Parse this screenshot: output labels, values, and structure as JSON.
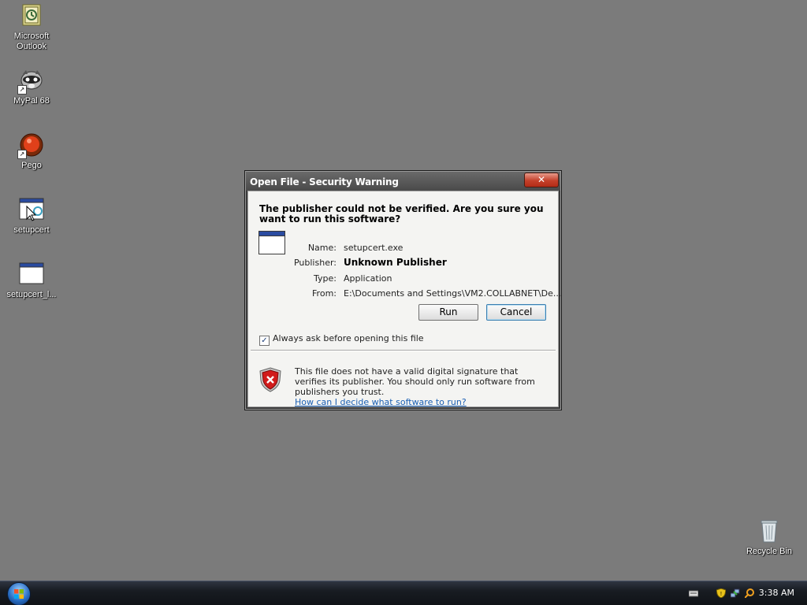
{
  "desktop": {
    "icons": [
      {
        "label_line1": "Microsoft",
        "label_line2": "Outlook",
        "icon": "outlook-icon"
      },
      {
        "label_line1": "MyPal 68",
        "label_line2": "",
        "icon": "mypal-icon"
      },
      {
        "label_line1": "Pego",
        "label_line2": "",
        "icon": "pego-icon"
      },
      {
        "label_line1": "setupcert",
        "label_line2": "",
        "icon": "setupcert-icon"
      },
      {
        "label_line1": "setupcert_l...",
        "label_line2": "",
        "icon": "setupcert-log-icon"
      }
    ],
    "recycle_bin": {
      "label": "Recycle Bin",
      "icon": "recycle-bin-icon"
    }
  },
  "dialog": {
    "title": "Open File - Security Warning",
    "close_glyph": "✕",
    "question": "The publisher could not be verified.  Are you sure you want to run this software?",
    "fields": {
      "name_label": "Name:",
      "name_value": "setupcert.exe",
      "publisher_label": "Publisher:",
      "publisher_value": "Unknown Publisher",
      "type_label": "Type:",
      "type_value": "Application",
      "from_label": "From:",
      "from_value": "E:\\Documents and Settings\\VM2.COLLABNET\\De..."
    },
    "run_label": "Run",
    "cancel_label": "Cancel",
    "checkbox_label": "Always ask before opening this file",
    "checkbox_checked": true,
    "warning_text": "This file does not have a valid digital signature that verifies its publisher.  You should only run software from publishers you trust.",
    "warning_link": "How can I decide what software to run?",
    "icon": "shield-error-icon"
  },
  "taskbar": {
    "clock": "3:38 AM",
    "tray_icons": [
      "keyboard-icon",
      "security-shield-icon",
      "network-icon",
      "search-icon"
    ]
  }
}
